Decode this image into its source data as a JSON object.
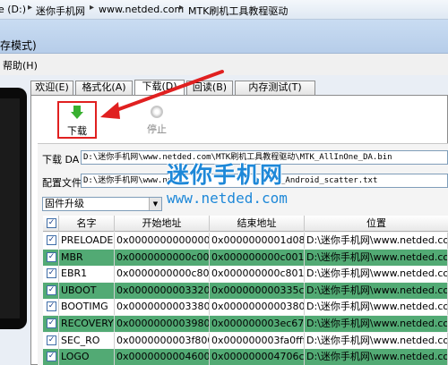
{
  "breadcrumb": {
    "prefix": "e (D:)",
    "items": [
      "迷你手机网",
      "www.netded.com",
      "MTK刷机工具教程驱动"
    ]
  },
  "window": {
    "title_fragment": "存模式)"
  },
  "menu": {
    "help": "帮助(H)"
  },
  "tabs": [
    {
      "label": "欢迎(E)"
    },
    {
      "label": "格式化(A)"
    },
    {
      "label": "下载(D)",
      "active": true
    },
    {
      "label": "回读(B)"
    },
    {
      "label": "内存测试(T)"
    }
  ],
  "toolbar": {
    "download_label": "下载",
    "stop_label": "停止"
  },
  "fields": {
    "da_label": "下载 DA",
    "da_value": "D:\\迷你手机网\\www.netded.com\\MTK刷机工具教程驱动\\MTK_AllInOne_DA.bin",
    "scatter_label": "配置文件",
    "scatter_value": "D:\\迷你手机网\\www.ne",
    "scatter_value_tail": "_Android_scatter.txt"
  },
  "watermark": {
    "cn": "迷你手机网",
    "url": "www.netded.com"
  },
  "mode_select": {
    "value": "固件升级"
  },
  "table": {
    "headers": [
      "",
      "名字",
      "开始地址",
      "结束地址",
      "位置"
    ],
    "rows": [
      {
        "name": "PRELOADER",
        "start": "0x0000000000000000",
        "end": "0x0000000001d08f",
        "location": "D:\\迷你手机网\\www.netded.com\\Br",
        "checked": true
      },
      {
        "name": "MBR",
        "start": "0x0000000000c00000",
        "end": "0x000000000c001ff",
        "location": "D:\\迷你手机网\\www.netded.com\\Br",
        "checked": true
      },
      {
        "name": "EBR1",
        "start": "0x0000000000c80000",
        "end": "0x000000000c801ff",
        "location": "D:\\迷你手机网\\www.netded.com\\Br",
        "checked": true
      },
      {
        "name": "UBOOT",
        "start": "0x0000000003320000",
        "end": "0x000000000335cedb",
        "location": "D:\\迷你手机网\\www.netded.com\\Br",
        "checked": true
      },
      {
        "name": "BOOTIMG",
        "start": "0x0000000003380000",
        "end": "0x000000000038097f",
        "location": "D:\\迷你手机网\\www.netded.com\\Br",
        "checked": true
      },
      {
        "name": "RECOVERY",
        "start": "0x0000000003980000",
        "end": "0x000000003ec67ff",
        "location": "D:\\迷你手机网\\www.netded.com\\Br",
        "checked": true
      },
      {
        "name": "SEC_RO",
        "start": "0x0000000003f80000",
        "end": "0x000000003fa0fff",
        "location": "D:\\迷你手机网\\www.netded.com\\Br",
        "checked": true
      },
      {
        "name": "LOGO",
        "start": "0x0000000004600000",
        "end": "0x000000004706c29",
        "location": "D:\\迷你手机网\\www.netded.com\\Br",
        "checked": true
      }
    ]
  },
  "colors": {
    "row_highlight": "#52aa74",
    "annotation_red": "#e02020",
    "watermark_blue": "#1e88d8"
  }
}
